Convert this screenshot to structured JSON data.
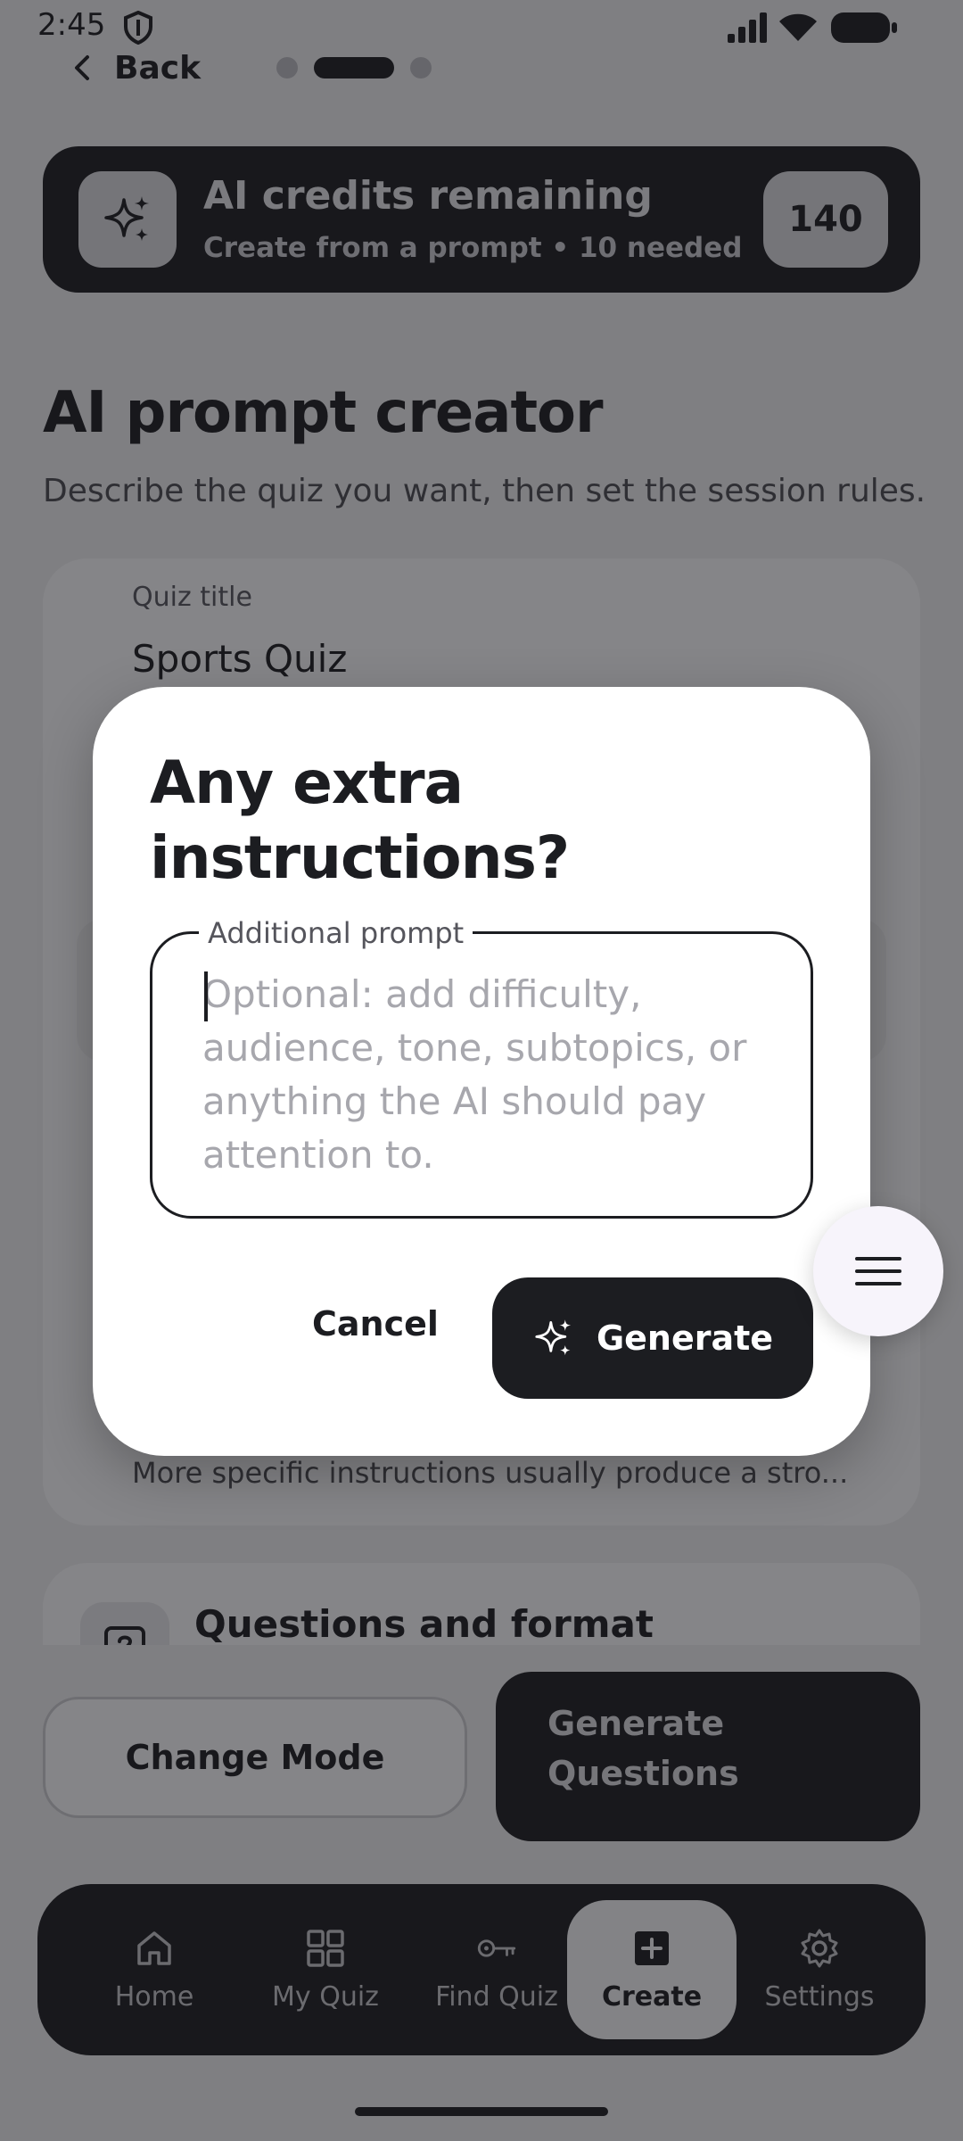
{
  "status_bar": {
    "time": "2:45"
  },
  "nav": {
    "back_label": "Back"
  },
  "credits": {
    "title": "AI credits remaining",
    "subtitle": "Create from a prompt • 10 needed",
    "count": "140"
  },
  "page": {
    "title": "AI prompt creator",
    "subtitle": "Describe the quiz you want, then set the session rules."
  },
  "form": {
    "quiz_title_label": "Quiz title",
    "quiz_title_value": "Sports Quiz",
    "hint": "More specific instructions usually produce a stro..."
  },
  "section": {
    "title": "Questions and format"
  },
  "actions": {
    "change_mode": "Change Mode",
    "generate_questions": "Generate Questions"
  },
  "bottom_nav": {
    "items": [
      {
        "label": "Home",
        "icon": "home-icon"
      },
      {
        "label": "My Quiz",
        "icon": "grid-icon"
      },
      {
        "label": "Find Quiz",
        "icon": "key-icon"
      },
      {
        "label": "Create",
        "icon": "add-box-icon"
      },
      {
        "label": "Settings",
        "icon": "gear-icon"
      }
    ],
    "active_index": 3
  },
  "dialog": {
    "title": "Any extra instructions?",
    "prompt_label": "Additional prompt",
    "prompt_placeholder": "Optional: add difficulty, audience, tone, subtopics, or anything the AI should pay attention to.",
    "cancel_label": "Cancel",
    "generate_label": "Generate"
  },
  "colors": {
    "primary_dark": "#1c1d21",
    "surface": "#ffffff",
    "fab_background": "#f7f4fb"
  }
}
